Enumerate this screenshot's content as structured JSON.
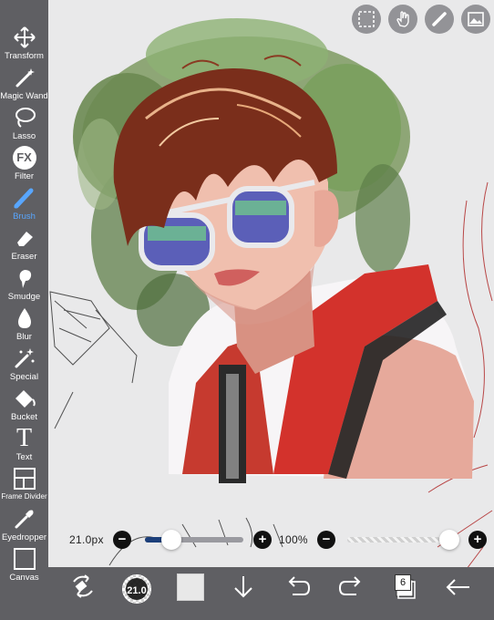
{
  "toolbar": {
    "tools": [
      {
        "label": "Transform",
        "icon": "move-arrows-icon"
      },
      {
        "label": "Magic Wand",
        "icon": "magic-wand-icon"
      },
      {
        "label": "Lasso",
        "icon": "lasso-icon"
      },
      {
        "label": "Filter",
        "icon": "fx-icon"
      },
      {
        "label": "Brush",
        "icon": "brush-icon",
        "active": true
      },
      {
        "label": "Eraser",
        "icon": "eraser-icon"
      },
      {
        "label": "Smudge",
        "icon": "smudge-icon"
      },
      {
        "label": "Blur",
        "icon": "droplet-icon"
      },
      {
        "label": "Special",
        "icon": "special-wand-icon"
      },
      {
        "label": "Bucket",
        "icon": "bucket-icon"
      },
      {
        "label": "Text",
        "icon": "text-icon"
      },
      {
        "label": "Frame Divider",
        "icon": "frame-divider-icon"
      },
      {
        "label": "Eyedropper",
        "icon": "eyedropper-icon"
      },
      {
        "label": "Canvas",
        "icon": "canvas-icon"
      }
    ],
    "fx_glyph": "FX",
    "text_glyph": "T"
  },
  "top_buttons": [
    "selection-icon",
    "hand-icon",
    "ruler-icon",
    "layer-image-icon"
  ],
  "sliders": {
    "brush_size": "21.0px",
    "brush_size_fraction": 0.17,
    "opacity": "100%",
    "opacity_fraction": 1.0,
    "minus": "−",
    "plus": "+"
  },
  "bottom_bar": {
    "brush_size_badge": "21.0",
    "color": "#e8e8e8",
    "layers_count": "6",
    "icons": [
      "tool-swap-icon",
      "brush-preview",
      "color-swatch",
      "download-icon",
      "undo-icon",
      "redo-icon",
      "layers-icon",
      "back-arrow-icon"
    ]
  },
  "colors": {
    "toolbar_bg": "#5f5f63",
    "active_tool": "#58a6ff",
    "slider_blue": "#1c3f7a"
  }
}
